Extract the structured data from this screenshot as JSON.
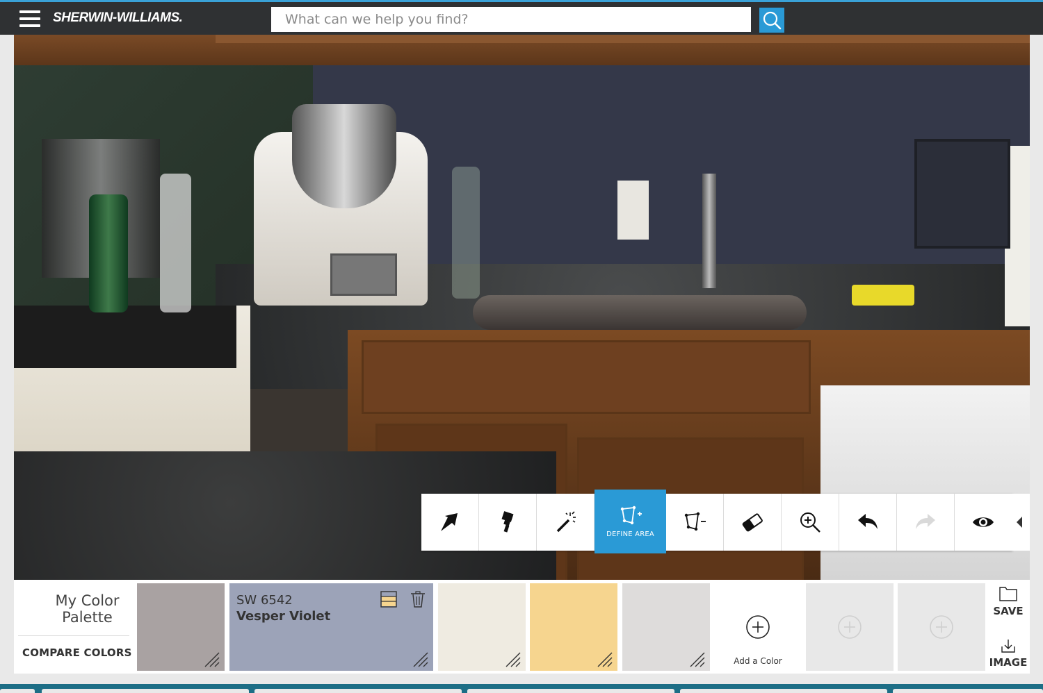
{
  "header": {
    "brand": "SHERWIN-WILLIAMS.",
    "search_placeholder": "What can we help you find?"
  },
  "icons": {
    "menu": "hamburger-icon",
    "search": "magnifier-icon"
  },
  "toolbar": {
    "tools": [
      {
        "name": "select-arrow-icon",
        "label": ""
      },
      {
        "name": "paint-brush-icon",
        "label": ""
      },
      {
        "name": "magic-wand-icon",
        "label": ""
      },
      {
        "name": "define-area-icon",
        "label": "DEFINE AREA",
        "active": true
      },
      {
        "name": "remove-area-icon",
        "label": ""
      },
      {
        "name": "eraser-icon",
        "label": ""
      },
      {
        "name": "zoom-in-icon",
        "label": ""
      },
      {
        "name": "undo-icon",
        "label": ""
      },
      {
        "name": "redo-icon",
        "label": ""
      },
      {
        "name": "eye-icon",
        "label": ""
      }
    ],
    "define_area_label": "DEFINE AREA",
    "accent": "#2a9ad6"
  },
  "palette": {
    "title_line1": "My Color",
    "title_line2": "Palette",
    "compare_label": "COMPARE COLORS",
    "selected": {
      "code": "SW 6542",
      "name": "Vesper Violet",
      "color": "#9ca3b8"
    },
    "swatch_colors": [
      "#a9a2a2",
      "#9ca3b8",
      "#efebe1",
      "#f6d58f",
      "#dedcdb"
    ],
    "add_color_label": "Add a Color",
    "save_label": "SAVE",
    "image_label": "IMAGE"
  }
}
